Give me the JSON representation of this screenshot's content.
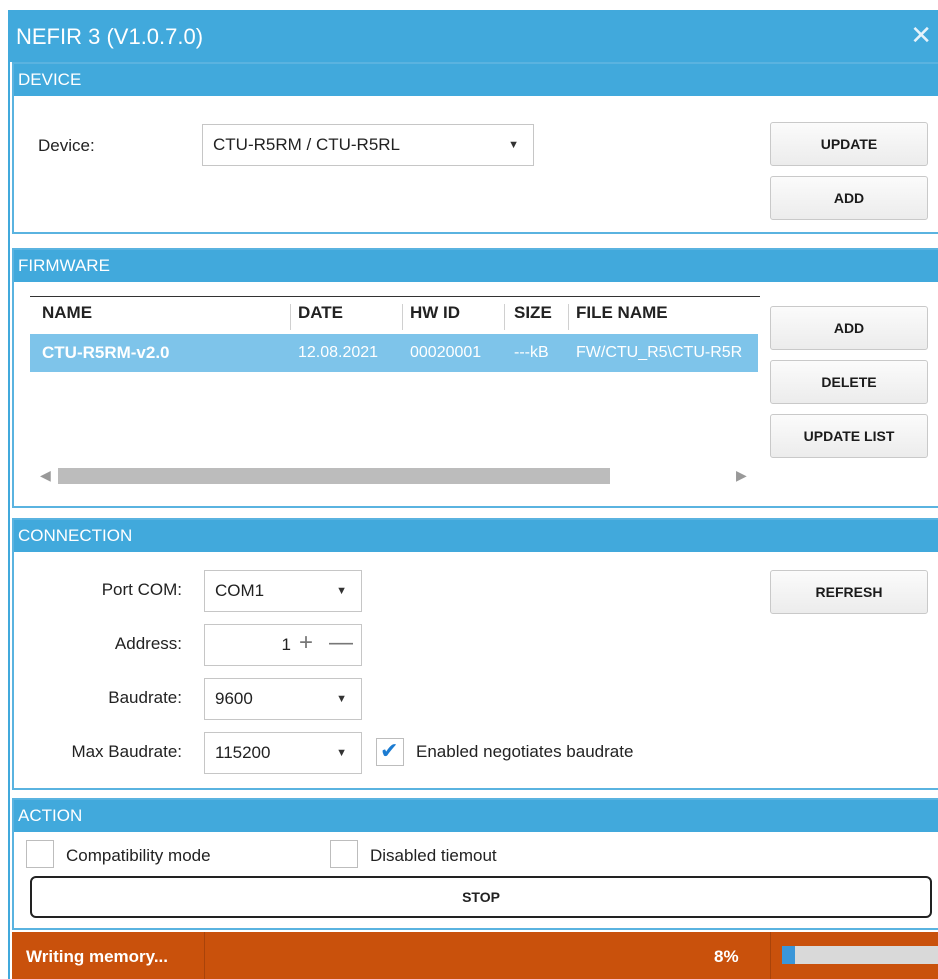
{
  "window": {
    "title": "NEFIR 3 (V1.0.7.0)",
    "close_icon": "close-icon"
  },
  "device": {
    "header": "DEVICE",
    "label": "Device:",
    "selected": "CTU-R5RM / CTU-R5RL",
    "update_label": "UPDATE",
    "add_label": "ADD"
  },
  "firmware": {
    "header": "FIRMWARE",
    "columns": [
      "NAME",
      "DATE",
      "HW ID",
      "SIZE",
      "FILE NAME"
    ],
    "rows": [
      {
        "name": "CTU-R5RM-v2.0",
        "date": "12.08.2021",
        "hw_id": "00020001",
        "size": "---kB",
        "file": "FW/CTU_R5\\CTU-R5R"
      }
    ],
    "add_label": "ADD",
    "delete_label": "DELETE",
    "update_list_label": "UPDATE LIST"
  },
  "connection": {
    "header": "CONNECTION",
    "port_label": "Port COM:",
    "port_value": "COM1",
    "address_label": "Address:",
    "address_value": "1",
    "baudrate_label": "Baudrate:",
    "baudrate_value": "9600",
    "max_baudrate_label": "Max Baudrate:",
    "max_baudrate_value": "115200",
    "negotiate_label": "Enabled negotiates baudrate",
    "negotiate_checked": true,
    "refresh_label": "REFRESH"
  },
  "action": {
    "header": "ACTION",
    "compat_label": "Compatibility mode",
    "compat_checked": false,
    "timeout_label": "Disabled tiemout",
    "timeout_checked": false,
    "stop_label": "STOP"
  },
  "status": {
    "text": "Writing memory...",
    "percent_label": "8%",
    "progress": 0.08
  },
  "colors": {
    "accent": "#41a9dc",
    "selection": "#7ec4ea",
    "status": "#c9510c"
  }
}
